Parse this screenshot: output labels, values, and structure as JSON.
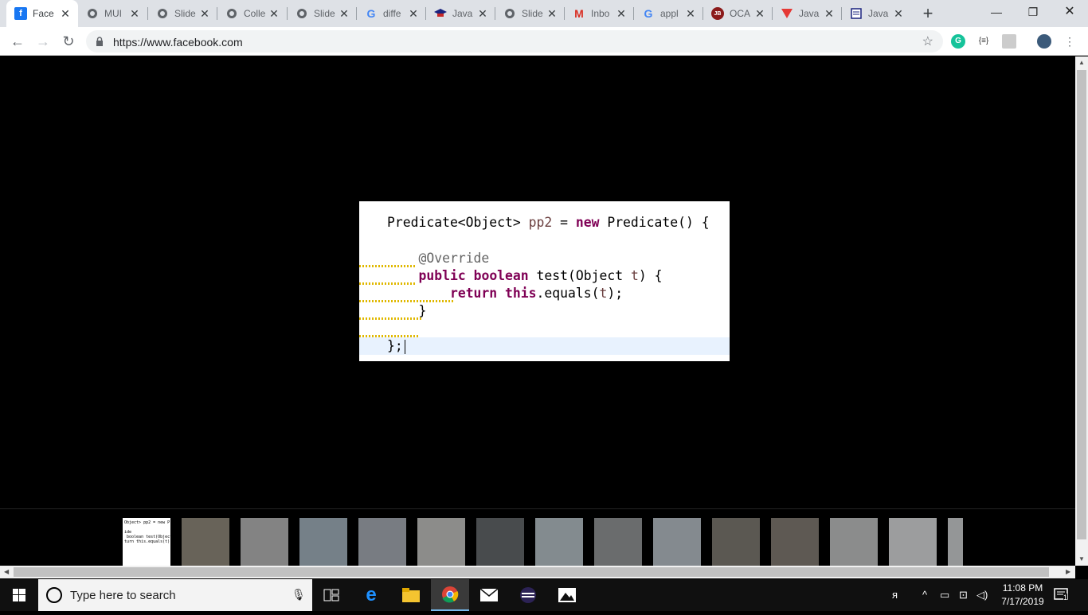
{
  "tabs": [
    {
      "title": "Face",
      "icon": "facebook-icon"
    },
    {
      "title": "MUI",
      "icon": "globe-icon"
    },
    {
      "title": "Slide",
      "icon": "globe-icon"
    },
    {
      "title": "Colle",
      "icon": "globe-icon"
    },
    {
      "title": "Slide",
      "icon": "globe-icon"
    },
    {
      "title": "diffe",
      "icon": "google-icon"
    },
    {
      "title": "Java",
      "icon": "graduation-cap-icon"
    },
    {
      "title": "Slide",
      "icon": "globe-icon"
    },
    {
      "title": "Inbo",
      "icon": "gmail-icon"
    },
    {
      "title": "appl",
      "icon": "google-icon"
    },
    {
      "title": "OCA",
      "icon": "jb-icon"
    },
    {
      "title": "Java",
      "icon": "v-logo-icon"
    },
    {
      "title": "Java",
      "icon": "document-icon"
    }
  ],
  "window_controls": {
    "minimize": "—",
    "restore": "❐",
    "close": "✕"
  },
  "address_bar": {
    "url": "https://www.facebook.com"
  },
  "code_lines": [
    "Predicate<Object> pp2 = new Predicate() {",
    "",
    "    @Override",
    "    public boolean test(Object t) {",
    "        return this.equals(t);",
    "    }",
    "",
    "};"
  ],
  "thumbnail_preview": "Object> pp2 = new Pr\n\nide\n boolean test(Object\nturn this.equals(t);",
  "taskbar": {
    "search_placeholder": "Type here to search",
    "time": "11:08 PM",
    "date": "7/17/2019",
    "notification_count": "1"
  },
  "colors": {
    "keyword": "#7f0055",
    "annotation": "#646464",
    "parameter": "#6a3e3e",
    "highlight_line": "#e8f2fe"
  }
}
